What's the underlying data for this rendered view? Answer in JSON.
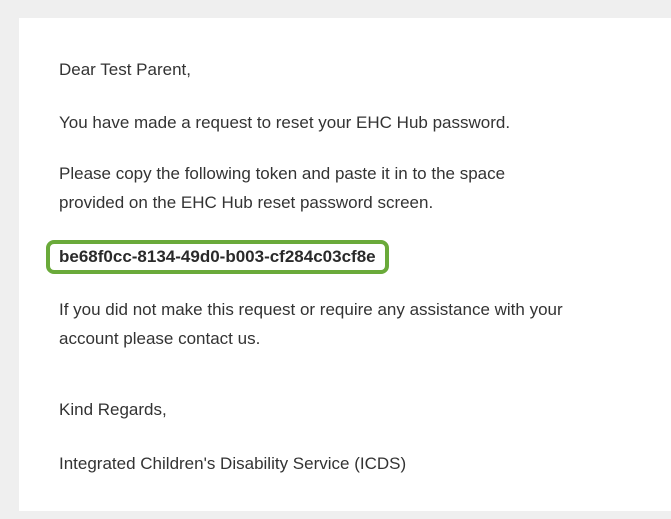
{
  "email": {
    "greeting": "Dear Test Parent,",
    "intro": "You have made a request to reset your EHC Hub password.",
    "instruction_line1": "Please copy the following token and paste it in to the space",
    "instruction_line2": "provided on the EHC Hub reset password screen.",
    "token": "be68f0cc-8134-49d0-b003-cf284c03cf8e",
    "help_line1": "If you did not make this request or require any assistance with your",
    "help_line2": "account please contact us.",
    "signoff": "Kind Regards,",
    "signature": "Integrated Children's Disability Service (ICDS)"
  },
  "colors": {
    "page_background": "#efefef",
    "card_background": "#ffffff",
    "text": "#333333",
    "token_highlight_border": "#6aaa3a"
  }
}
